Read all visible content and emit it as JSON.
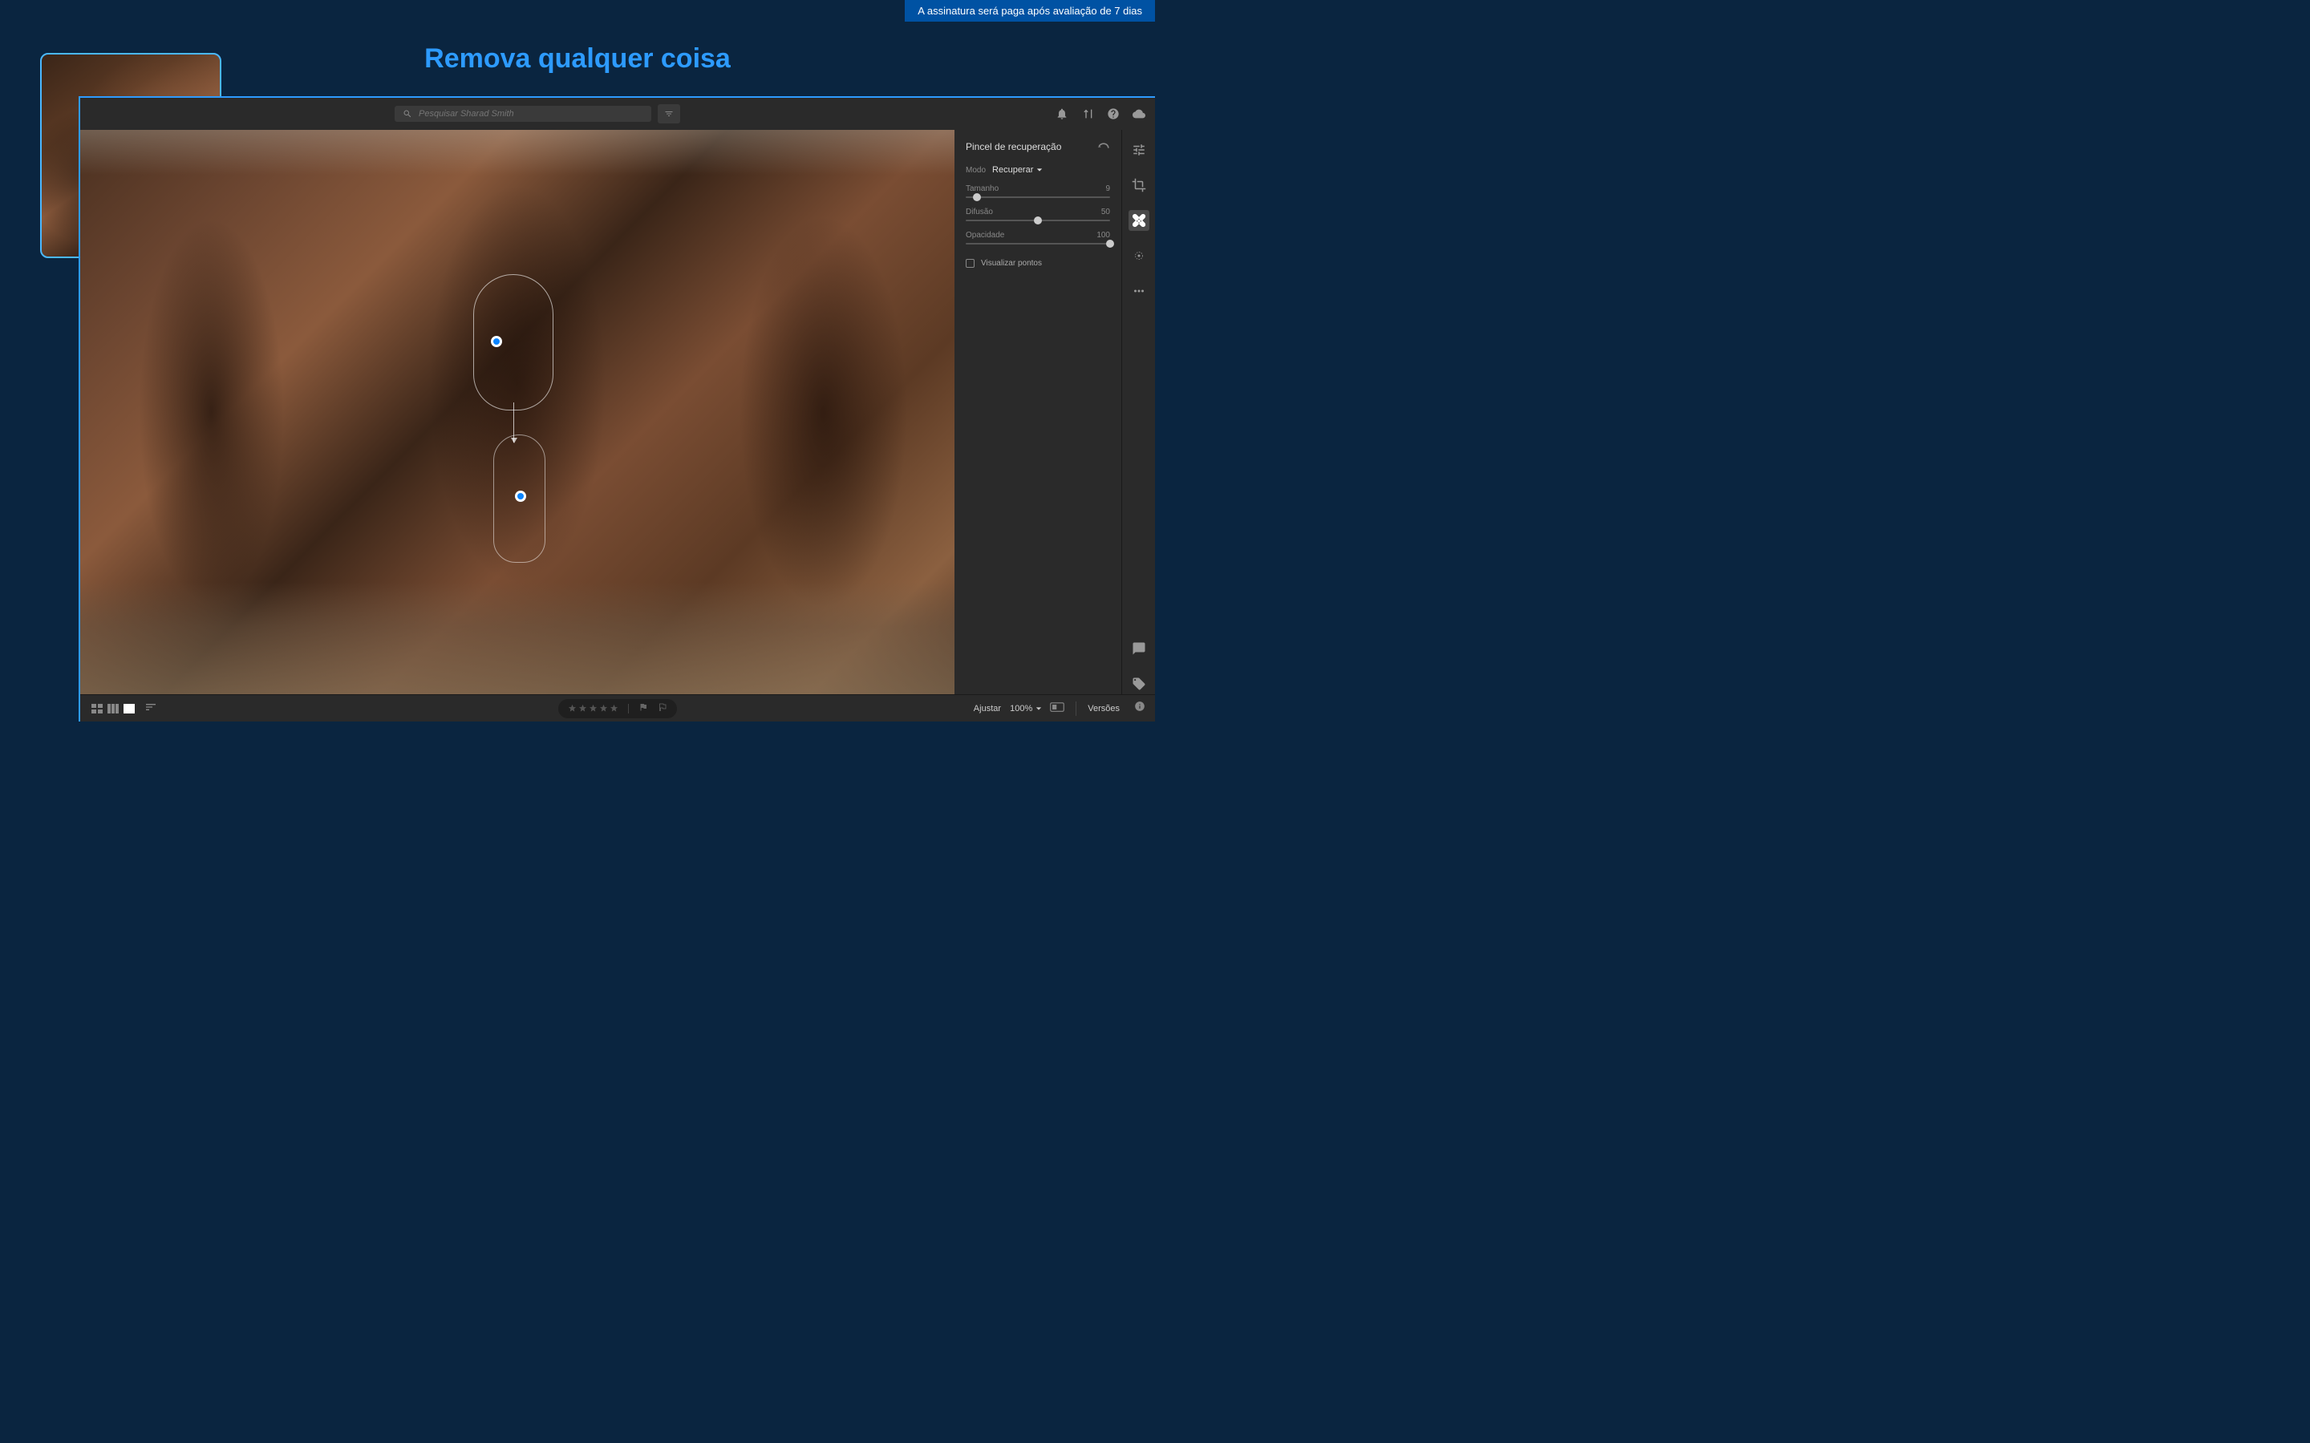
{
  "banner": "A assinatura será paga após avaliação de 7 dias",
  "headline": "Remova qualquer coisa",
  "search": {
    "placeholder": "Pesquisar Sharad Smith"
  },
  "panel": {
    "title": "Pincel de recuperação",
    "mode_label": "Modo",
    "mode_value": "Recuperar",
    "sliders": [
      {
        "label": "Tamanho",
        "value": "9",
        "pos": 8
      },
      {
        "label": "Difusão",
        "value": "50",
        "pos": 50
      },
      {
        "label": "Opacidade",
        "value": "100",
        "pos": 100
      }
    ],
    "checkbox": "Visualizar pontos"
  },
  "bottombar": {
    "fit": "Ajustar",
    "zoom": "100%",
    "versions": "Versões"
  }
}
